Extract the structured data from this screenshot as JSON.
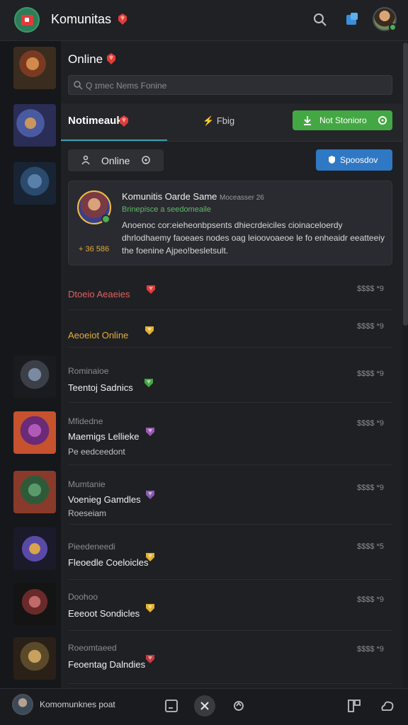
{
  "header": {
    "title": "Komunitas",
    "icons": [
      "gem-icon",
      "search-icon",
      "notification-icon",
      "profile-avatar"
    ]
  },
  "left_rail": {
    "thumbnails": [
      "champion-thumb-1",
      "champion-thumb-2",
      "champion-thumb-3",
      "champion-thumb-4",
      "champion-thumb-5",
      "champion-thumb-6",
      "champion-thumb-7",
      "champion-thumb-8",
      "champion-thumb-9"
    ]
  },
  "online": {
    "title": "Online",
    "search_placeholder": "Q ɪmec Nems Fonine"
  },
  "tabs": {
    "tab1": "Notimeauk",
    "tab2": "Fbig",
    "green_button": "Not Stonioro",
    "chip": "Online",
    "blue_button": "Spoosdov"
  },
  "card": {
    "title": "Komunitis Oarde Same",
    "title_meta": "Moceasser 26",
    "subtitle": "Brinepisce a seedomeaile",
    "body": "Anoenoc cor:eieheonbpsents dhiecrdeiciles cioinaceloerdy dhrlodhaemy faoeaes nodes oag leioovoaeoe le fo enheaidr eeatteeiy the foenine Ajpeo!besletsult.",
    "points": "+ 36 586"
  },
  "rows": [
    {
      "title": "Dtoeio Aeaeies",
      "sub": "",
      "meta": "$$$$ *9",
      "title_color": "#e26060"
    },
    {
      "title": "Aeoeiot Online",
      "sub": "",
      "meta": "$$$$ *9",
      "title_color": "#e0b03a"
    },
    {
      "title": "Teentoj Sadnics",
      "sub": "Rominaioe",
      "meta": "$$$$ *9",
      "title_color": "#f0f0f0"
    },
    {
      "title": "Maemigs Lellieke",
      "sub": "Mfidedne",
      "sub2": "Pe eedceedont",
      "meta": "$$$$ *9",
      "title_color": "#f0f0f0"
    },
    {
      "title": "Voenieg Gamdles",
      "sub": "Mumtanie",
      "sub2": "Roeseiam",
      "meta": "$$$$ *9",
      "title_color": "#f0f0f0"
    },
    {
      "title": "Fleoedle Coeloicles",
      "sub": "Pieedeneedi",
      "meta": "$$$$ *5",
      "title_color": "#f0f0f0"
    },
    {
      "title": "Eeeoot Sondicles",
      "sub": "Doohoo",
      "meta": "$$$$ *9",
      "title_color": "#f0f0f0"
    },
    {
      "title": "Feoentag Dalndies",
      "sub": "Roeomtaeed",
      "meta": "$$$$ *9",
      "title_color": "#f0f0f0"
    }
  ],
  "bottom_bar": {
    "status": "Komomunknes poat",
    "icons": [
      "layout-icon",
      "close-icon",
      "share-icon",
      "grid-icon",
      "cloud-icon"
    ]
  },
  "colors": {
    "accent_green": "#43a843",
    "accent_blue": "#2f78c4",
    "gem_red": "#e23b3b",
    "gold": "#e2a93a"
  }
}
